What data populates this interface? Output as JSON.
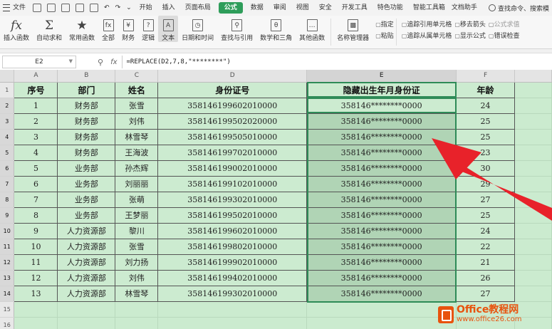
{
  "menu": {
    "file": "文件",
    "tabs": [
      "开始",
      "插入",
      "页面布局",
      "公式",
      "数据",
      "审阅",
      "视图",
      "安全",
      "开发工具",
      "特色功能",
      "智能工具箱",
      "文档助手"
    ],
    "active_tab": "公式",
    "search": "查找命令、搜索模"
  },
  "ribbon": {
    "insert_function": "插入函数",
    "autosum": "自动求和",
    "common_functions": "常用函数",
    "all": "全部",
    "finance": "财务",
    "logic": "逻辑",
    "text": "文本",
    "datetime": "日期和时间",
    "lookup": "查找与引用",
    "math": "数学和三角",
    "other": "其他函数",
    "name_manager": "名称管理器",
    "specify": "指定",
    "paste": "粘贴",
    "trace_precedents": "追踪引用单元格",
    "trace_dependents": "追踪从属单元格",
    "move_arrow": "移去箭头",
    "show_formula": "显示公式",
    "formula_eval": "公式求值",
    "error_check": "错误检查"
  },
  "formula_bar": {
    "cell_ref": "E2",
    "formula": "=REPLACE(D2,7,8,\"********\")"
  },
  "sheet": {
    "columns": [
      "A",
      "B",
      "C",
      "D",
      "E",
      "F"
    ],
    "header": [
      "序号",
      "部门",
      "姓名",
      "身份证号",
      "隐藏出生年月身份证",
      "年龄"
    ],
    "rows": [
      [
        "1",
        "财务部",
        "张雪",
        "358146199602010000",
        "358146********0000",
        "24"
      ],
      [
        "2",
        "财务部",
        "刘伟",
        "358146199502020000",
        "358146********0000",
        "25"
      ],
      [
        "3",
        "财务部",
        "林雪琴",
        "358146199505010000",
        "358146********0000",
        "25"
      ],
      [
        "4",
        "财务部",
        "王海波",
        "358146199702010000",
        "358146********0000",
        "23"
      ],
      [
        "5",
        "业务部",
        "孙杰辉",
        "358146199002010000",
        "358146********0000",
        "30"
      ],
      [
        "6",
        "业务部",
        "刘丽丽",
        "358146199102010000",
        "358146********0000",
        "29"
      ],
      [
        "7",
        "业务部",
        "张萌",
        "358146199302010000",
        "358146********0000",
        "27"
      ],
      [
        "8",
        "业务部",
        "王梦丽",
        "358146199502010000",
        "358146********0000",
        "25"
      ],
      [
        "9",
        "人力资源部",
        "黎川",
        "358146199602010000",
        "358146********0000",
        "24"
      ],
      [
        "10",
        "人力资源部",
        "张雪",
        "358146199802010000",
        "358146********0000",
        "22"
      ],
      [
        "11",
        "人力资源部",
        "刘力扬",
        "358146199902010000",
        "358146********0000",
        "21"
      ],
      [
        "12",
        "人力资源部",
        "刘伟",
        "358146199402010000",
        "358146********0000",
        "26"
      ],
      [
        "13",
        "人力资源部",
        "林雪琴",
        "358146199302010000",
        "358146********0000",
        "27"
      ]
    ]
  },
  "watermark": {
    "title": "Office教程网",
    "url": "www.office26.com"
  },
  "colors": {
    "accent": "#2e9d5a",
    "arrow": "#e8222a",
    "grid": "#cbebcf",
    "watermark": "#e8530e"
  }
}
